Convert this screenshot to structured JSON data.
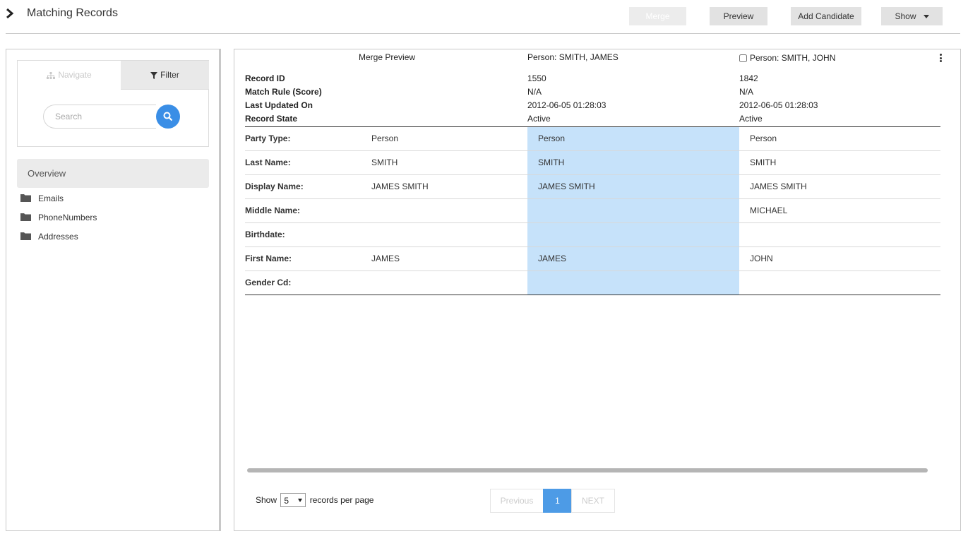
{
  "header": {
    "title": "Matching Records",
    "buttons": {
      "merge": "Merge",
      "preview": "Preview",
      "add_candidate": "Add Candidate",
      "show": "Show"
    }
  },
  "left_panel": {
    "tabs": {
      "navigate": "Navigate",
      "filter": "Filter"
    },
    "search": {
      "placeholder": "Search"
    },
    "overview": "Overview",
    "tree": [
      "Emails",
      "PhoneNumbers",
      "Addresses"
    ]
  },
  "main": {
    "columns": {
      "preview": "Merge Preview",
      "record_a": "Person: SMITH, JAMES",
      "record_b": "Person: SMITH, JOHN"
    },
    "meta_labels": [
      "Record ID",
      "Match Rule (Score)",
      "Last Updated On",
      "Record State"
    ],
    "record_a_meta": [
      "1550",
      "N/A",
      "2012-06-05 01:28:03",
      "Active"
    ],
    "record_b_meta": [
      "1842",
      "N/A",
      "2012-06-05 01:28:03",
      "Active"
    ],
    "rows": [
      {
        "label": "Party Type:",
        "preview": "Person",
        "a": "Person",
        "b": "Person"
      },
      {
        "label": "Last Name:",
        "preview": "SMITH",
        "a": "SMITH",
        "b": "SMITH"
      },
      {
        "label": "Display Name:",
        "preview": "JAMES SMITH",
        "a": "JAMES SMITH",
        "b": "JAMES SMITH"
      },
      {
        "label": "Middle Name:",
        "preview": "",
        "a": "",
        "b": "MICHAEL"
      },
      {
        "label": "Birthdate:",
        "preview": "",
        "a": "",
        "b": ""
      },
      {
        "label": "First Name:",
        "preview": "JAMES",
        "a": "JAMES",
        "b": "JOHN"
      },
      {
        "label": "Gender Cd:",
        "preview": "",
        "a": "",
        "b": ""
      }
    ],
    "footer": {
      "show_label": "Show",
      "per_page_value": "5",
      "per_page_suffix": "records per page",
      "previous": "Previous",
      "page": "1",
      "next": "NEXT"
    }
  },
  "colors": {
    "accent": "#3a8ee6",
    "highlight": "#c6e2fa",
    "active_page": "#4d9be6"
  }
}
